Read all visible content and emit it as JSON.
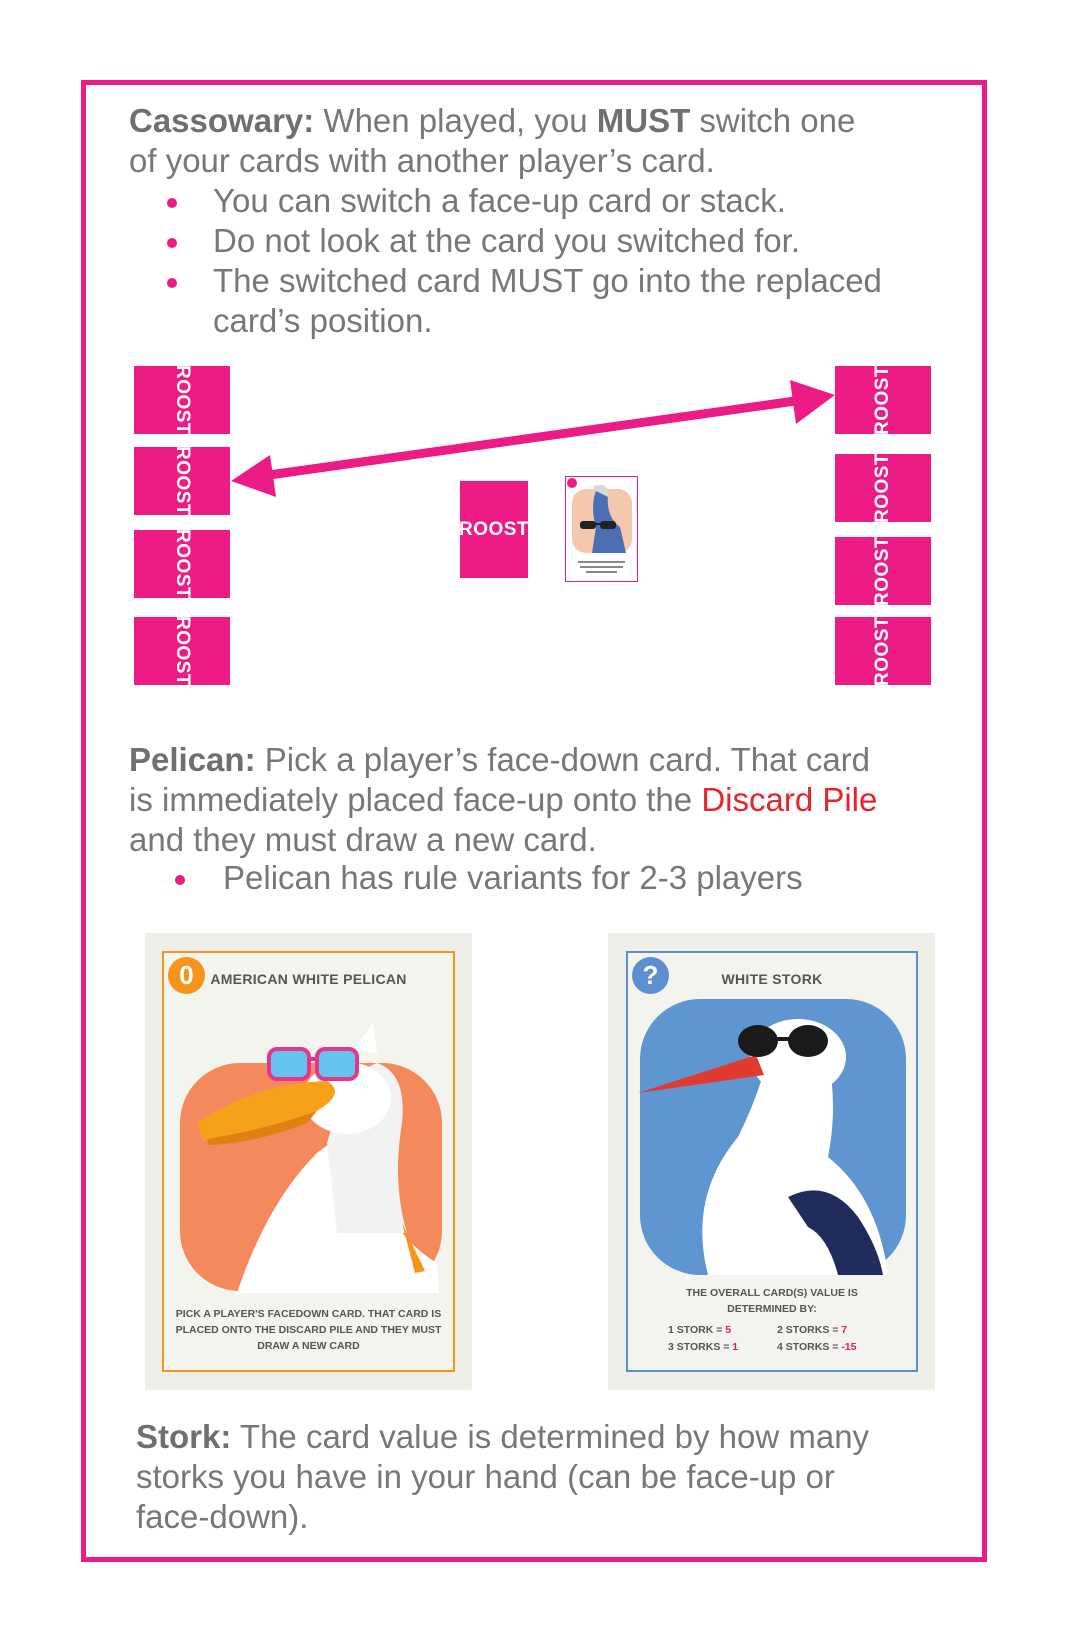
{
  "cassowary": {
    "name": "Cassowary:",
    "text_pre": " When played, you ",
    "must": "MUST",
    "text_post": " switch one of your cards with another player’s card.",
    "bullets": [
      "You can switch a face-up card or stack.",
      "Do not look at the card you switched for.",
      "The switched card MUST go into the replaced card’s position."
    ]
  },
  "diagram": {
    "card_back_text": "ROOST",
    "colors": {
      "accent": "#ec1b86",
      "arrow": "#ec1b86"
    }
  },
  "pelican": {
    "name": "Pelican:",
    "text_pre": " Pick a player’s face-down card. That card is immediately placed face-up onto the ",
    "discard": "Discard Pile",
    "text_post": " and they must draw a new card.",
    "bullets": [
      "Pelican has rule variants for 2-3 players"
    ]
  },
  "pelican_card": {
    "value": "0",
    "title": "AMERICAN WHITE PELICAN",
    "description": "PICK A PLAYER'S FACEDOWN CARD. THAT CARD IS PLACED ONTO THE DISCARD PILE AND THEY MUST DRAW A NEW CARD",
    "colors": {
      "border": "#f7941d",
      "background": "#f4895c"
    }
  },
  "stork_card": {
    "value": "?",
    "title": "WHITE STORK",
    "description": "THE OVERALL CARD(S) VALUE IS DETERMINED BY:",
    "scores": [
      {
        "label": "1 STORK = ",
        "value": "5"
      },
      {
        "label": "2 STORKS = ",
        "value": "7"
      },
      {
        "label": "3 STORKS = ",
        "value": "1"
      },
      {
        "label": "4 STORKS = ",
        "value": "-15"
      }
    ],
    "colors": {
      "border": "#5b8fcf",
      "background": "#5f95d0"
    }
  },
  "stork": {
    "name": "Stork:",
    "text": " The card value is determined by how many storks you have in your hand (can be face-up or face-down)."
  }
}
